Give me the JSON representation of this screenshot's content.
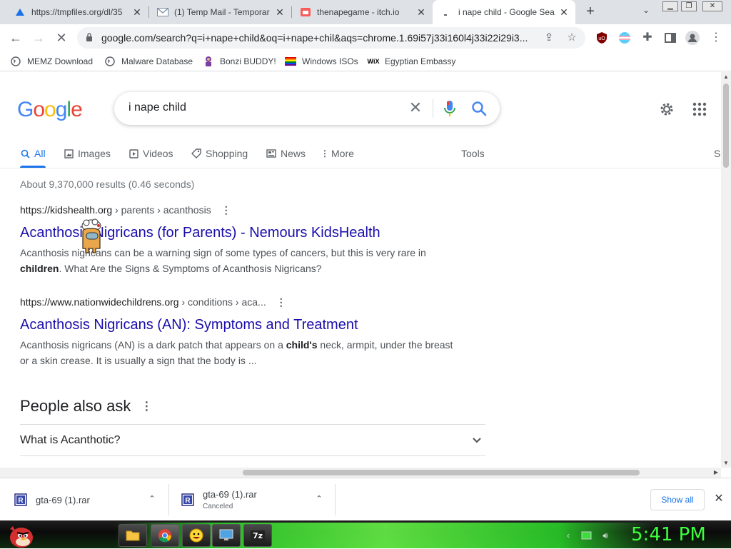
{
  "browser": {
    "tabs": [
      {
        "title": "https://tmpfiles.org/dl/35",
        "icon": "cloud-icon"
      },
      {
        "title": "(1) Temp Mail - Temporar",
        "icon": "mail-icon"
      },
      {
        "title": "thenapegame - itch.io",
        "icon": "itch-icon"
      },
      {
        "title": "i nape child - Google Sea",
        "icon": "loading-icon",
        "active": true
      }
    ],
    "new_tab": "+",
    "url": "google.com/search?q=i+nape+child&oq=i+nape+chil&aqs=chrome.1.69i57j33i160l4j33i22i29i3...",
    "bookmarks": [
      {
        "label": "MEMZ Download",
        "icon": "globe-icon"
      },
      {
        "label": "Malware Database",
        "icon": "globe-icon"
      },
      {
        "label": "Bonzi BUDDY!",
        "icon": "bonzi-icon"
      },
      {
        "label": "Windows ISOs",
        "icon": "rainbow-flag-icon"
      },
      {
        "label": "Egyptian Embassy",
        "icon": "wix-icon"
      }
    ]
  },
  "google": {
    "logo": [
      "G",
      "o",
      "o",
      "g",
      "l",
      "e"
    ],
    "logo_colors": [
      "#4285f4",
      "#ea4335",
      "#fbbc05",
      "#4285f4",
      "#34a853",
      "#ea4335"
    ],
    "query": "i nape child",
    "tabs": [
      {
        "label": "All",
        "icon": "search-icon"
      },
      {
        "label": "Images",
        "icon": "image-icon"
      },
      {
        "label": "Videos",
        "icon": "play-icon"
      },
      {
        "label": "Shopping",
        "icon": "tag-icon"
      },
      {
        "label": "News",
        "icon": "news-icon"
      },
      {
        "label": "More",
        "icon": "more-vert-icon"
      }
    ],
    "tools": "Tools",
    "safe_partial": "S",
    "stats": "About 9,370,000 results (0.46 seconds)",
    "results": [
      {
        "site": "https://kidshealth.org",
        "path": " › parents › acanthosis",
        "title": "Acanthosis Nigricans (for Parents) - Nemours KidsHealth",
        "snippet_pre": "Acanthosis nigricans can be a warning sign of some types of cancers, but this is very rare in ",
        "snippet_bold": "children",
        "snippet_post": ". What Are the Signs & Symptoms of Acanthosis Nigricans?"
      },
      {
        "site": "https://www.nationwidechildrens.org",
        "path": " › conditions › aca...",
        "title": "Acanthosis Nigricans (AN): Symptoms and Treatment",
        "snippet_pre": "Acanthosis nigricans (AN) is a dark patch that appears on a ",
        "snippet_bold": "child's",
        "snippet_post": " neck, armpit, under the breast or a skin crease. It is usually a sign that the body is ..."
      }
    ],
    "paa_title": "People also ask",
    "paa_questions": [
      "What is Acanthotic?"
    ]
  },
  "downloads": {
    "items": [
      {
        "name": "gta-69 (1).rar",
        "status": ""
      },
      {
        "name": "gta-69 (1).rar",
        "status": "Canceled"
      }
    ],
    "show_all": "Show all"
  },
  "taskbar": {
    "apps": [
      "folder-icon",
      "chrome-icon",
      "emoji-icon",
      "monitor-icon",
      "7zip-icon"
    ],
    "clock": "5:41 PM",
    "seven_zip": "7z"
  }
}
